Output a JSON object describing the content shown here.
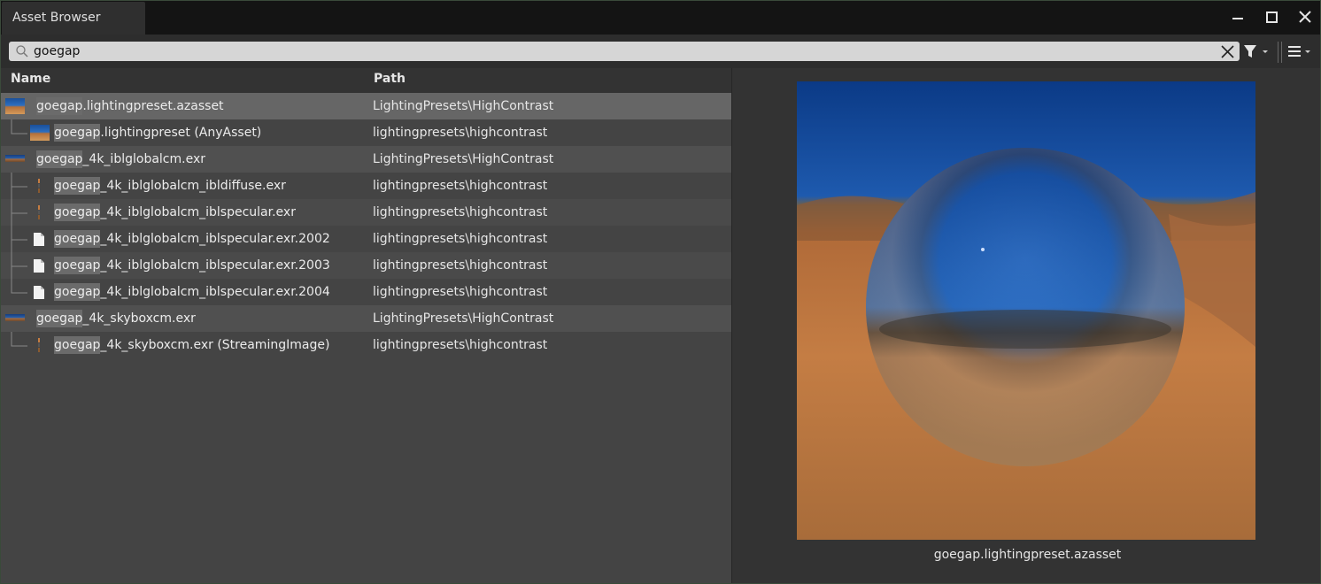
{
  "window": {
    "title": "Asset Browser"
  },
  "search": {
    "value": "goegap",
    "placeholder": ""
  },
  "columns": {
    "name": "Name",
    "path": "Path"
  },
  "rows": [
    {
      "highlight": "goegap",
      "rest": ".lightingpreset.azasset",
      "path": "LightingPresets\\HighContrast"
    },
    {
      "highlight": "goegap",
      "rest": ".lightingpreset (AnyAsset)",
      "path": "lightingpresets\\highcontrast"
    },
    {
      "highlight": "goegap",
      "rest": "_4k_iblglobalcm.exr",
      "path": "LightingPresets\\HighContrast"
    },
    {
      "highlight": "goegap",
      "rest": "_4k_iblglobalcm_ibldiffuse.exr",
      "path": "lightingpresets\\highcontrast"
    },
    {
      "highlight": "goegap",
      "rest": "_4k_iblglobalcm_iblspecular.exr",
      "path": "lightingpresets\\highcontrast"
    },
    {
      "highlight": "goegap",
      "rest": "_4k_iblglobalcm_iblspecular.exr.2002",
      "path": "lightingpresets\\highcontrast"
    },
    {
      "highlight": "goegap",
      "rest": "_4k_iblglobalcm_iblspecular.exr.2003",
      "path": "lightingpresets\\highcontrast"
    },
    {
      "highlight": "goegap",
      "rest": "_4k_iblglobalcm_iblspecular.exr.2004",
      "path": "lightingpresets\\highcontrast"
    },
    {
      "highlight": "goegap",
      "rest": "_4k_skyboxcm.exr",
      "path": "LightingPresets\\HighContrast"
    },
    {
      "highlight": "goegap",
      "rest": "_4k_skyboxcm.exr (StreamingImage)",
      "path": "lightingpresets\\highcontrast"
    }
  ],
  "preview": {
    "caption": "goegap.lightingpreset.azasset"
  },
  "colors": {
    "background": "#444444",
    "titlebar": "#141414",
    "selection": "#666666",
    "highlight": "#6b6b6b"
  },
  "icons": [
    "search-icon",
    "clear-icon",
    "filter-icon",
    "menu-icon",
    "minimize-icon",
    "maximize-icon",
    "close-icon",
    "file-icon",
    "image-thumbnail-icon"
  ]
}
